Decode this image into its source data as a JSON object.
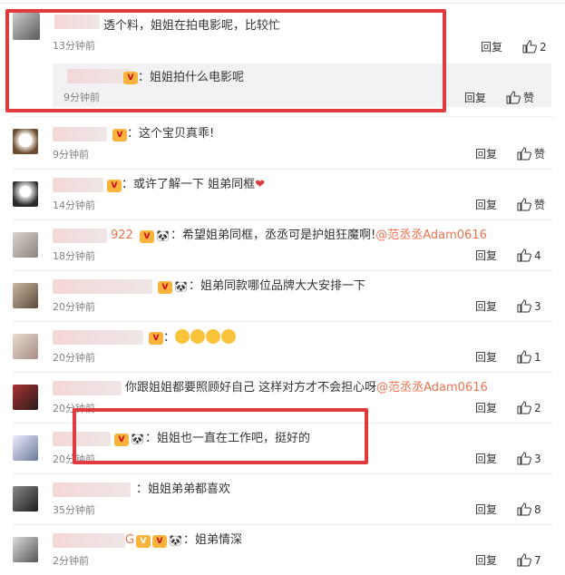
{
  "comments": [
    {
      "text": "透个料，姐姐在拍电影呢，比较忙",
      "time": "13分钟前",
      "reply": "回复",
      "likes": "2"
    },
    {
      "text": "：姐姐拍什么电影呢",
      "time": "9分钟前",
      "reply": "回复",
      "likes": "赞"
    },
    {
      "text": "：这个宝贝真乖!",
      "time": "9分钟前",
      "reply": "回复",
      "likes": "赞"
    },
    {
      "text": "：或许了解一下 姐弟同框",
      "time": "14分钟前",
      "reply": "回复",
      "likes": "赞"
    },
    {
      "text": "：希望姐弟同框，丞丞可是护姐狂魔啊!",
      "mention": "@范丞丞Adam0616",
      "nick_tail": "922",
      "time": "18分钟前",
      "reply": "回复",
      "likes": "4"
    },
    {
      "text": "：姐弟同款哪位品牌大大安排一下",
      "time": "20分钟前",
      "reply": "回复",
      "likes": "3"
    },
    {
      "text": "：",
      "time": "20分钟前",
      "reply": "回复",
      "likes": "1"
    },
    {
      "text": "你跟姐姐都要照顾好自己 这样对方才不会担心呀",
      "mention": "@范丞丞Adam0616",
      "time": "20分钟前",
      "reply": "回复",
      "likes": "2"
    },
    {
      "text": "：姐姐也一直在工作吧，挺好的",
      "time": "20分钟前",
      "reply": "回复",
      "likes": "3"
    },
    {
      "text": "：姐姐弟弟都喜欢",
      "time": "35分钟前",
      "reply": "回复",
      "likes": "8"
    },
    {
      "text": "：姐弟情深",
      "nick_tail": "G",
      "time": "2分钟前",
      "reply": "回复",
      "likes": "7"
    }
  ],
  "colors": {
    "highlight": "#e03a3e",
    "mention": "#eb7350",
    "badge": "#f7b33b"
  },
  "icons": {
    "like": "thumbs-up-icon",
    "badge": "vip-badge-icon",
    "panda": "panda-emoji-icon",
    "heart": "heart-emoji-icon"
  }
}
